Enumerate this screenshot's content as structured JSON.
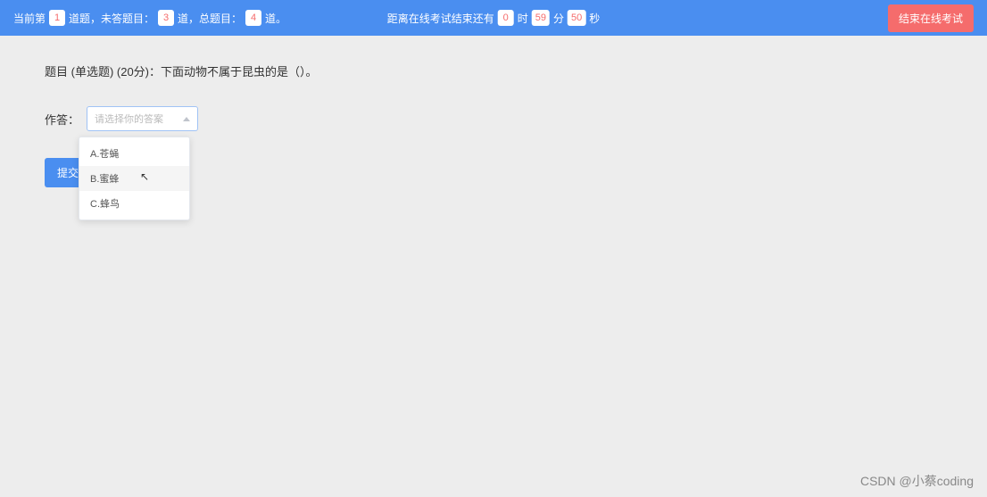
{
  "header": {
    "current_prefix": "当前第",
    "current_num": "1",
    "current_suffix": "道题，未答题目：",
    "unanswered_num": "3",
    "mid_text": "道，总题目：",
    "total_num": "4",
    "end_text": "道。",
    "timer_prefix": "距离在线考试结束还有",
    "hours": "0",
    "hours_label": "时",
    "minutes": "59",
    "minutes_label": "分",
    "seconds": "50",
    "seconds_label": "秒",
    "end_exam_btn": "结束在线考试"
  },
  "question": {
    "text": "题目 (单选题) (20分)：下面动物不属于昆虫的是（）。"
  },
  "answer": {
    "label": "作答：",
    "placeholder": "请选择你的答案",
    "options": [
      {
        "label": "A.苍蝇"
      },
      {
        "label": "B.蜜蜂"
      },
      {
        "label": "C.蜂鸟"
      }
    ]
  },
  "submit": {
    "label": "提交答案"
  },
  "watermark": "CSDN @小蔡coding"
}
